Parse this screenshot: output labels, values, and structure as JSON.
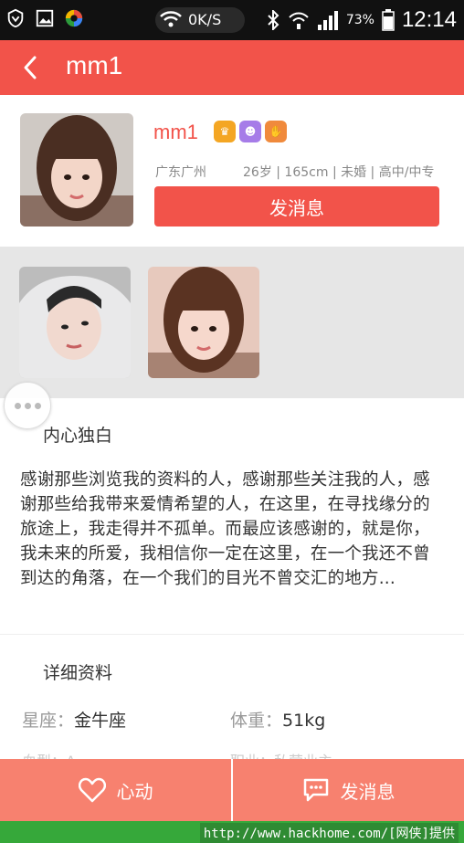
{
  "status_bar": {
    "network_speed": "0K/S",
    "battery_percent": "73%",
    "time": "12:14",
    "icons": [
      "shield-icon",
      "image-icon",
      "colorful-app-icon",
      "wifi-icon",
      "bluetooth-icon",
      "wifi-signal-icon",
      "cell-signal-icon",
      "battery-icon"
    ]
  },
  "header": {
    "title": "mm1",
    "back_icon": "back-arrow-icon",
    "color": "#f2534a"
  },
  "profile": {
    "name": "mm1",
    "badges": [
      "crown-badge",
      "purple-badge",
      "hand-badge"
    ],
    "location": "广东广州",
    "details": "26岁 | 165cm | 未婚 | 高中/中专",
    "message_button": "发消息"
  },
  "photos": [
    "photo-1",
    "photo-2"
  ],
  "monologue": {
    "title": "内心独白",
    "text": "感谢那些浏览我的资料的人，感谢那些关注我的人，感谢那些给我带来爱情希望的人，在这里，在寻找缘分的旅途上，我走得并不孤单。而最应该感谢的，就是你，我未来的所爱，我相信你一定在这里，在一个我还不曾到达的角落，在一个我们的目光不曾交汇的地方..."
  },
  "details": {
    "title": "详细资料",
    "rows": [
      {
        "key": "星座：",
        "value": "金牛座"
      },
      {
        "key": "体重：",
        "value": "51kg"
      }
    ],
    "faded_left": "血型：A",
    "faded_right": "职业：私营业主"
  },
  "bottom_bar": {
    "like_label": "心动",
    "message_label": "发消息",
    "color": "#f7816f"
  },
  "watermark": "http://www.hackhome.com/[网侠]提供"
}
